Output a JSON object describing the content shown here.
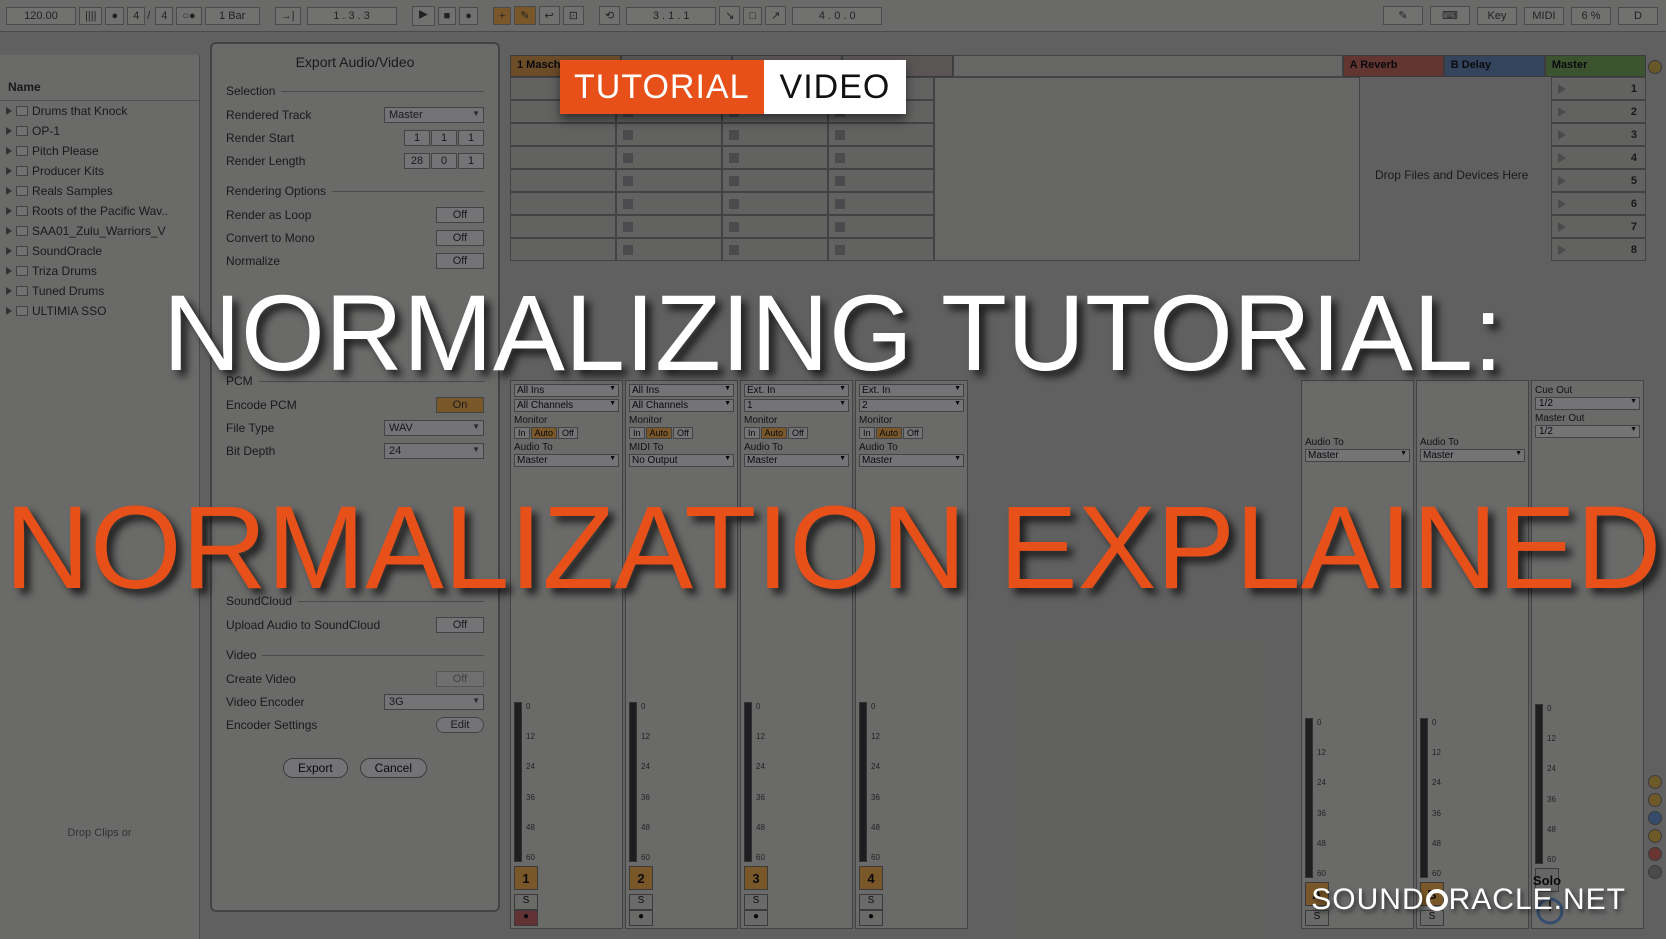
{
  "transport": {
    "tempo": "120.00",
    "sig_num": "4",
    "sig_den": "4",
    "quantize": "1 Bar",
    "position": "1 . 3 . 3",
    "arr_position": "3 . 1 . 1",
    "loop_len": "4 . 0 . 0",
    "key_label": "Key",
    "midi_label": "MIDI",
    "midi_pct": "6 %",
    "d_label": "D"
  },
  "browser": {
    "header": "Name",
    "items": [
      "Drums that Knock",
      "OP-1",
      "Pitch Please",
      "Producer Kits",
      "Reals Samples",
      "Roots of the Pacific Wav..",
      "SAA01_Zulu_Warriors_V",
      "SoundOracle",
      "Triza Drums",
      "Tuned Drums",
      "ULTIMIA SSO"
    ],
    "drop_hint": "Drop Clips or"
  },
  "dialog": {
    "title": "Export Audio/Video",
    "sections": {
      "selection": "Selection",
      "rendering": "Rendering Options",
      "pcm": "PCM",
      "soundcloud": "SoundCloud",
      "video": "Video"
    },
    "rendered_track_label": "Rendered Track",
    "rendered_track_value": "Master",
    "render_start_label": "Render Start",
    "render_start": [
      "1",
      "1",
      "1"
    ],
    "render_length_label": "Render Length",
    "render_length": [
      "28",
      "0",
      "1"
    ],
    "render_loop_label": "Render as Loop",
    "render_loop": "Off",
    "mono_label": "Convert to Mono",
    "mono": "Off",
    "normalize_label": "Normalize",
    "normalize": "Off",
    "encode_pcm_label": "Encode PCM",
    "encode_pcm": "On",
    "file_type_label": "File Type",
    "file_type": "WAV",
    "bit_depth_label": "Bit Depth",
    "bit_depth": "24",
    "upload_label": "Upload Audio to SoundCloud",
    "upload": "Off",
    "create_video_label": "Create Video",
    "create_video": "Off",
    "video_encoder_label": "Video Encoder",
    "video_encoder": "3G",
    "encoder_settings_label": "Encoder Settings",
    "encoder_settings_btn": "Edit",
    "export_btn": "Export",
    "cancel_btn": "Cancel"
  },
  "tracks": {
    "headers": [
      "1 Masch",
      "",
      "",
      "",
      "A Reverb",
      "B Delay",
      "Master"
    ],
    "scene_numbers": [
      "1",
      "2",
      "3",
      "4",
      "5",
      "6",
      "7",
      "8"
    ],
    "drop_hint": "Drop Files and Devices Here"
  },
  "mixer": {
    "all_ins": "All Ins",
    "all_channels": "All Channels",
    "ext_in": "Ext. In",
    "ch1": "1",
    "ch2": "2",
    "monitor_label": "Monitor",
    "mon_in": "In",
    "mon_auto": "Auto",
    "mon_off": "Off",
    "audio_to_label": "Audio To",
    "midi_to_label": "MIDI To",
    "master": "Master",
    "no_output": "No Output",
    "cue_out_label": "Cue Out",
    "cue_out": "1/2",
    "master_out_label": "Master Out",
    "master_out": "1/2",
    "solo": "Solo",
    "scale": [
      "0",
      "12",
      "24",
      "36",
      "48",
      "60"
    ],
    "track_nums": [
      "1",
      "2",
      "3",
      "4"
    ],
    "send_labels": [
      "A",
      "B"
    ],
    "s_label": "S"
  },
  "overlay": {
    "badge_l": "TUTORIAL",
    "badge_r": "VIDEO",
    "title1": "NORMALIZING TUTORIAL:",
    "title2": "NORMALIZATION EXPLAINED",
    "brand_a": "SOUND",
    "brand_b": "RACLE.NET"
  }
}
